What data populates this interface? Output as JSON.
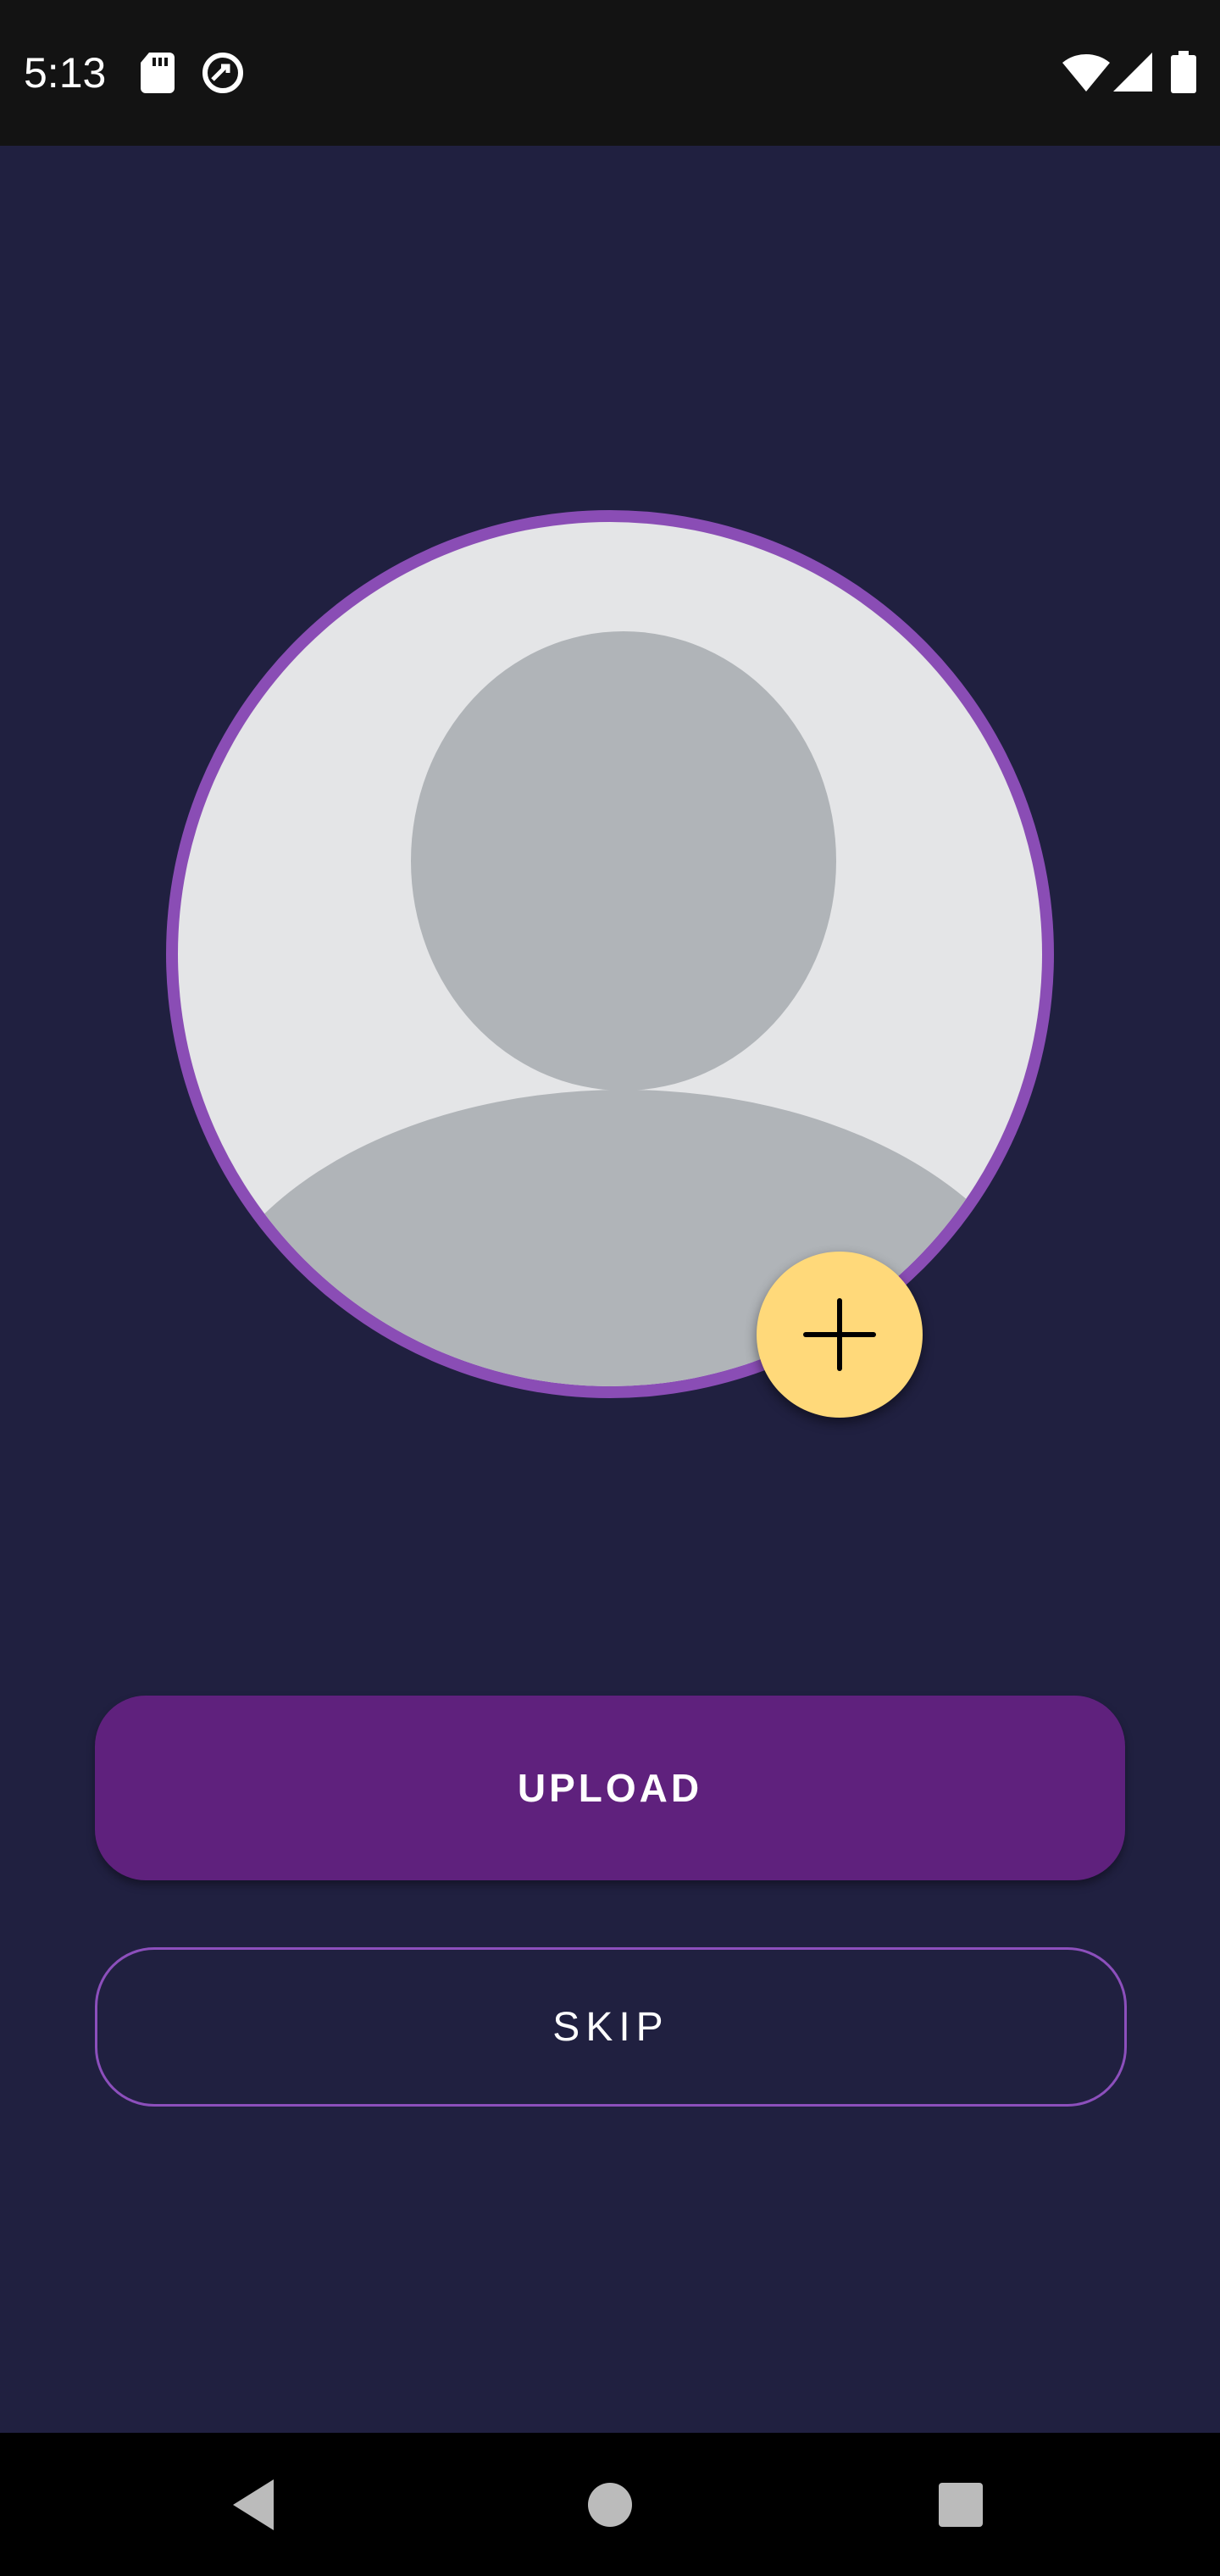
{
  "status_bar": {
    "time": "5:13",
    "icons": [
      "sd-card-icon",
      "data-saver-icon",
      "wifi-icon",
      "cell-signal-icon",
      "battery-icon"
    ]
  },
  "avatar": {
    "icon": "person-placeholder-icon",
    "ring_color": "#8a4db5",
    "background_color": "#e4e5e7",
    "silhouette_color": "#b0b4b8"
  },
  "fab": {
    "icon": "plus-icon",
    "color": "#ffd97a"
  },
  "actions": {
    "upload_label": "UPLOAD",
    "skip_label": "SKIP",
    "upload_color": "#5f217d",
    "skip_border_color": "#8c4fbc"
  },
  "nav_bar": {
    "icons": [
      "back-icon",
      "home-icon",
      "recents-icon"
    ]
  },
  "theme": {
    "background": "#202040"
  }
}
